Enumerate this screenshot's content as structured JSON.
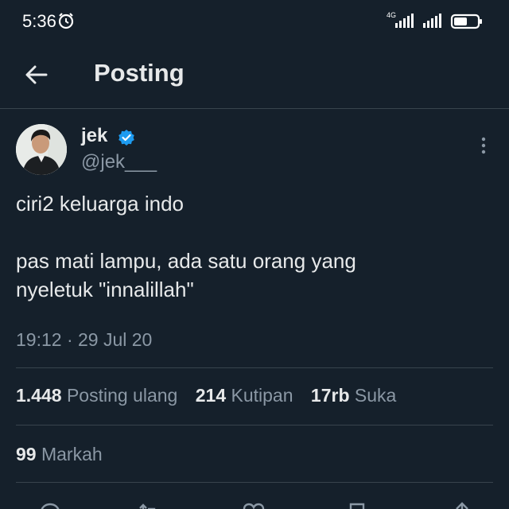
{
  "status_bar": {
    "time": "5:36",
    "network": "4G"
  },
  "header": {
    "title": "Posting"
  },
  "tweet": {
    "author": {
      "name": "jek",
      "handle": "@jek___"
    },
    "text_line1": "ciri2 keluarga indo",
    "text_line2": "pas mati lampu, ada satu orang yang",
    "text_line3": "nyeletuk \"innalillah\"",
    "timestamp": "19:12 · 29 Jul 20"
  },
  "stats": {
    "reposts_count": "1.448",
    "reposts_label": "Posting ulang",
    "quotes_count": "214",
    "quotes_label": "Kutipan",
    "likes_count": "17rb",
    "likes_label": "Suka",
    "bookmarks_count": "99",
    "bookmarks_label": "Markah"
  },
  "icons": {
    "back": "arrow-left-icon",
    "verified": "verified-badge-icon",
    "more": "more-vertical-icon",
    "alarm": "alarm-clock-icon",
    "battery": "battery-icon",
    "reply": "reply-icon",
    "repost": "repost-icon",
    "like": "heart-icon",
    "bookmark": "bookmark-icon",
    "share": "share-icon"
  },
  "colors": {
    "background": "#15202b",
    "primary_text": "#e7e9ea",
    "secondary_text": "#8b98a5",
    "divider": "#38444d",
    "verified": "#1d9bf0"
  }
}
